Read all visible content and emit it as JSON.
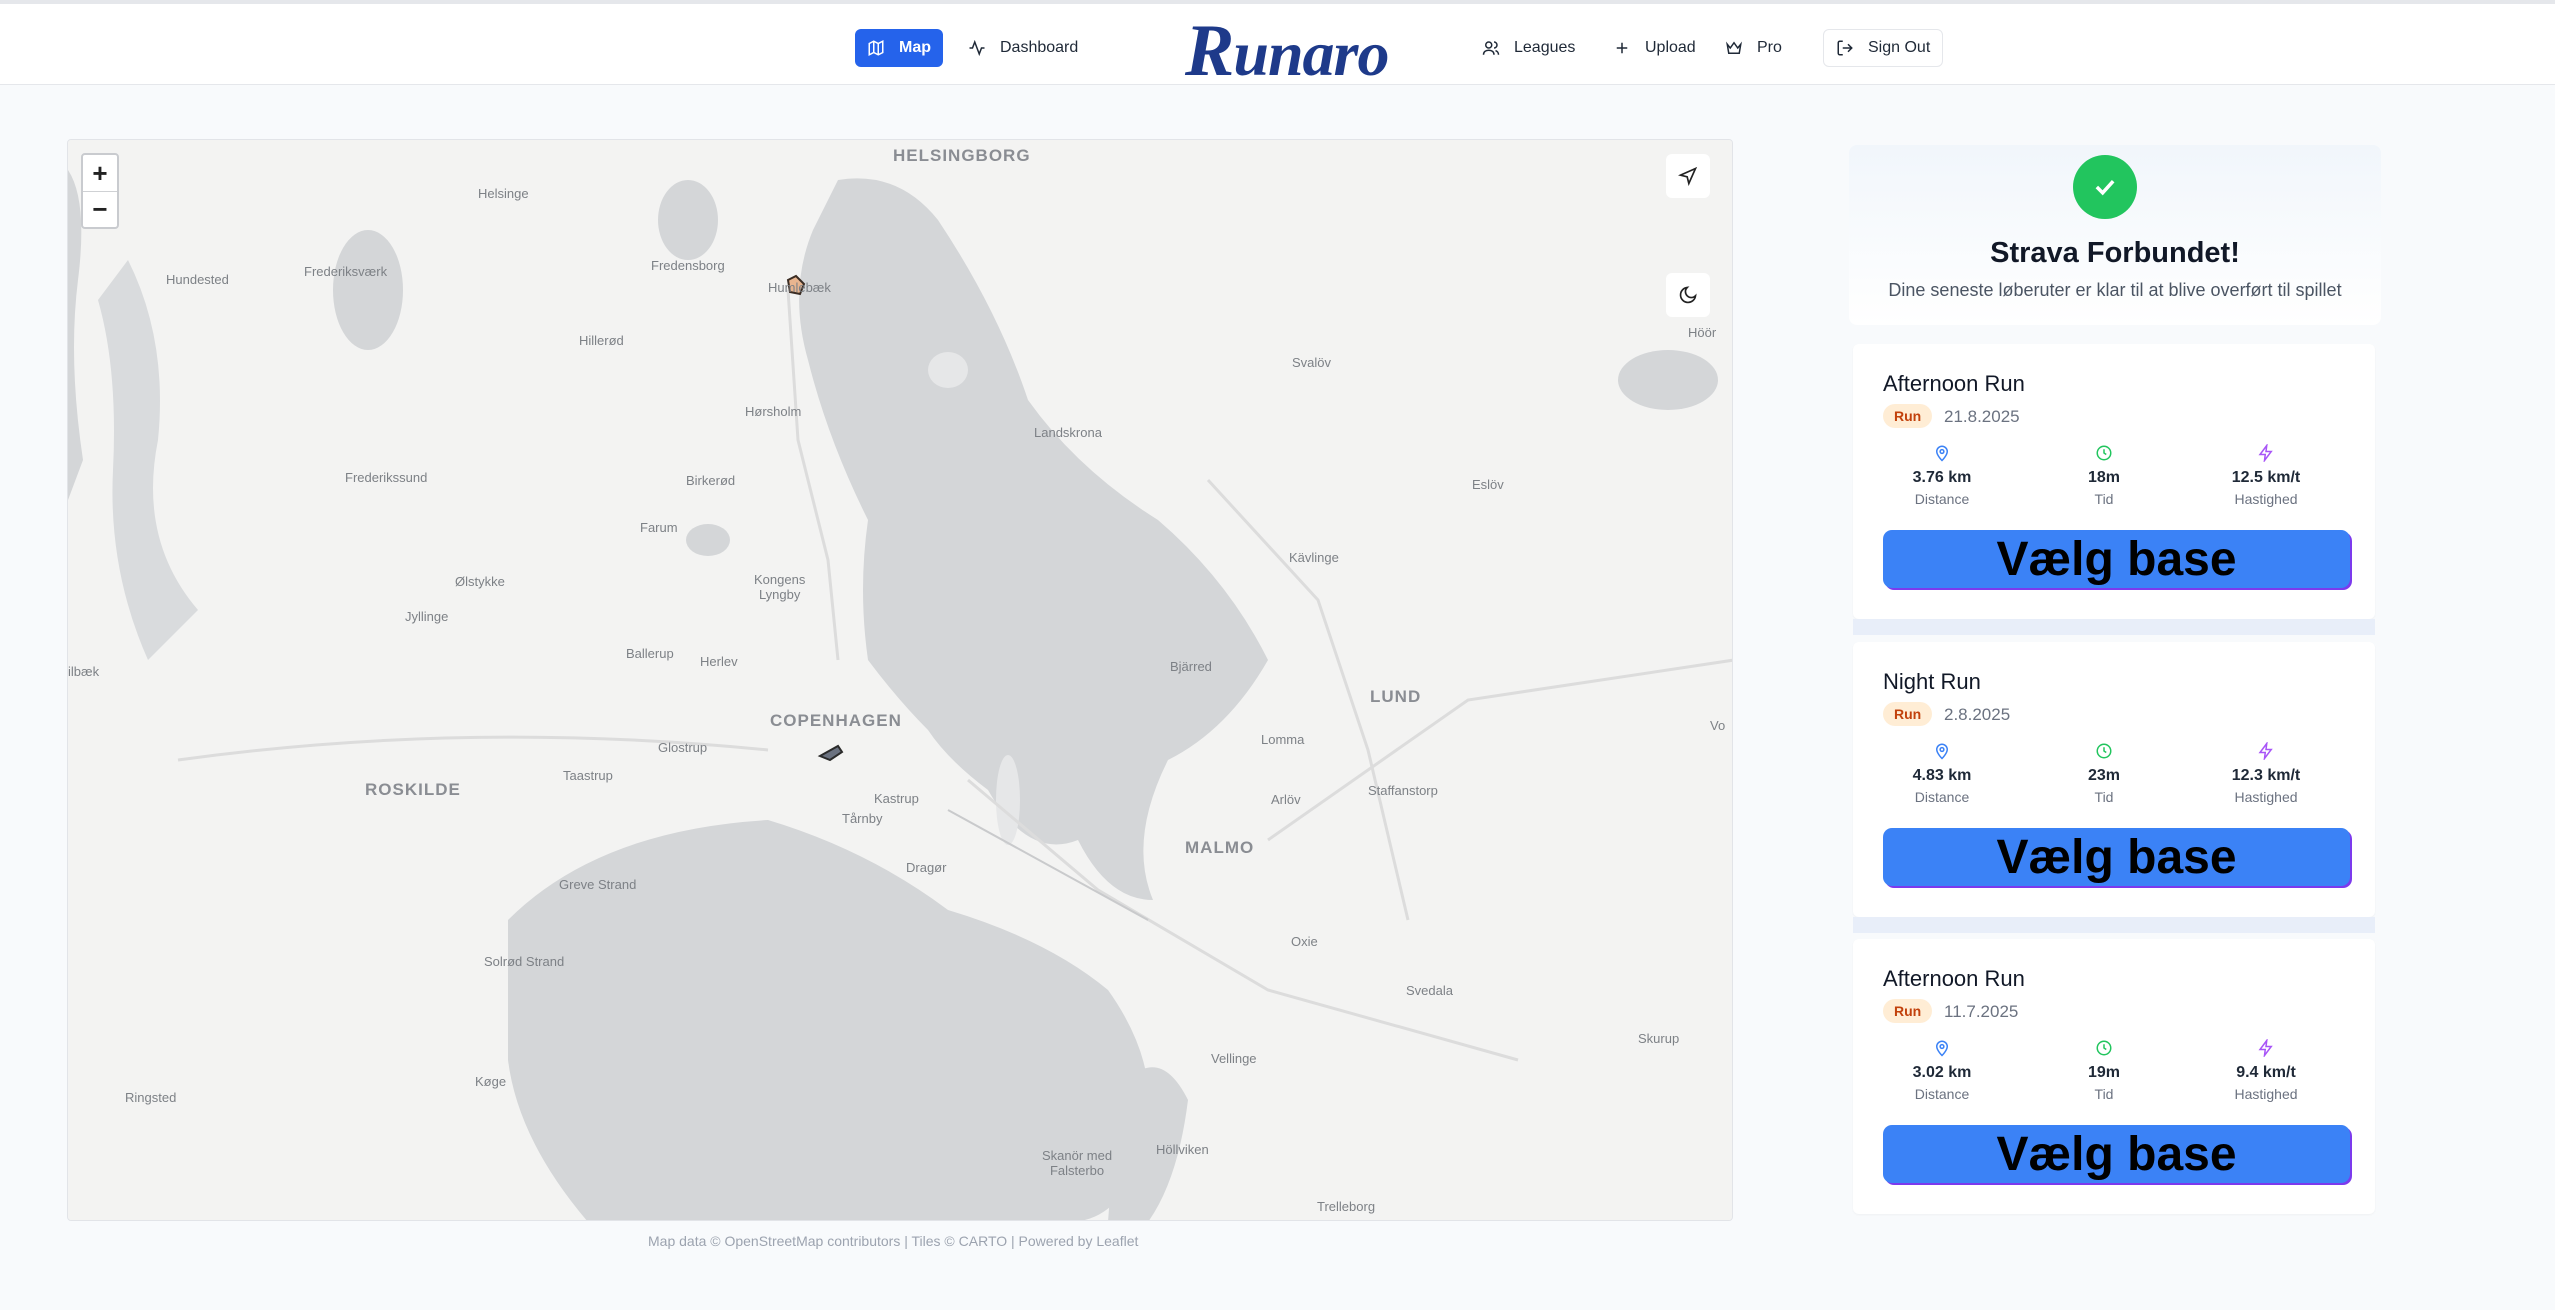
{
  "nav": {
    "map": "Map",
    "dashboard": "Dashboard",
    "logo_first": "R",
    "logo_rest": "unaro",
    "leagues": "Leagues",
    "upload": "Upload",
    "pro": "Pro",
    "signout": "Sign Out"
  },
  "map": {
    "zoom_in": "+",
    "zoom_out": "−",
    "labels": {
      "helsingborg": "HELSINGBORG",
      "helsinge": "Helsinge",
      "frederiksvaerk": "Frederiksværk",
      "hundested": "Hundested",
      "fredensborg": "Fredensborg",
      "humlebaek": "Humlebæk",
      "hilleroed": "Hillerød",
      "svaloev": "Svalöv",
      "hoeoer": "Höör",
      "hoersholm": "Hørsholm",
      "landskrona": "Landskrona",
      "frederikssund": "Frederikssund",
      "birkeroed": "Birkerød",
      "esloev": "Eslöv",
      "farum": "Farum",
      "kongens_lyngby": "Kongens\nLyngby",
      "oelstykke": "Ølstykke",
      "kaevlinge": "Kävlinge",
      "jyllinge": "Jyllinge",
      "ballerup": "Ballerup",
      "herlev": "Herlev",
      "bjaerred": "Bjärred",
      "lund": "LUND",
      "copenhagen": "COPENHAGEN",
      "glostrup": "Glostrup",
      "lomma": "Lomma",
      "roskilde": "ROSKILDE",
      "taastrup": "Taastrup",
      "kastrup": "Kastrup",
      "taarnby": "Tårnby",
      "arloev": "Arlöv",
      "staffanstorp": "Staffanstorp",
      "malmo": "MALMO",
      "dragoer": "Dragør",
      "greve_strand": "Greve Strand",
      "oxie": "Oxie",
      "solroed_strand": "Solrød Strand",
      "svedala": "Svedala",
      "skurup": "Skurup",
      "koege": "Køge",
      "vellinge": "Vellinge",
      "ringsted": "Ringsted",
      "hoellviken": "Höllviken",
      "skanoer": "Skanör med\nFalsterbo",
      "trelleborg": "Trelleborg",
      "vaerloese": "ilbæk",
      "vo": "Vo"
    },
    "attribution": "Map data © OpenStreetMap contributors | Tiles © CARTO | Powered by Leaflet"
  },
  "panel": {
    "title": "Strava Forbundet!",
    "subtitle": "Dine seneste løberuter er klar til at blive overført til spillet"
  },
  "runs": [
    {
      "title": "Afternoon Run",
      "type": "Run",
      "date": "21.8.2025",
      "distance": "3.76 km",
      "distance_label": "Distance",
      "time": "18m",
      "time_label": "Tid",
      "speed": "12.5 km/t",
      "speed_label": "Hastighed",
      "button": "Vælg base"
    },
    {
      "title": "Night Run",
      "type": "Run",
      "date": "2.8.2025",
      "distance": "4.83 km",
      "distance_label": "Distance",
      "time": "23m",
      "time_label": "Tid",
      "speed": "12.3 km/t",
      "speed_label": "Hastighed",
      "button": "Vælg base"
    },
    {
      "title": "Afternoon Run",
      "type": "Run",
      "date": "11.7.2025",
      "distance": "3.02 km",
      "distance_label": "Distance",
      "time": "19m",
      "time_label": "Tid",
      "speed": "9.4 km/t",
      "speed_label": "Hastighed",
      "button": "Vælg base"
    }
  ],
  "colors": {
    "primary": "#2563eb",
    "success": "#22c55e",
    "button": "#3b82f6",
    "badge_bg": "#ffedd5",
    "badge_text": "#c2410c"
  }
}
